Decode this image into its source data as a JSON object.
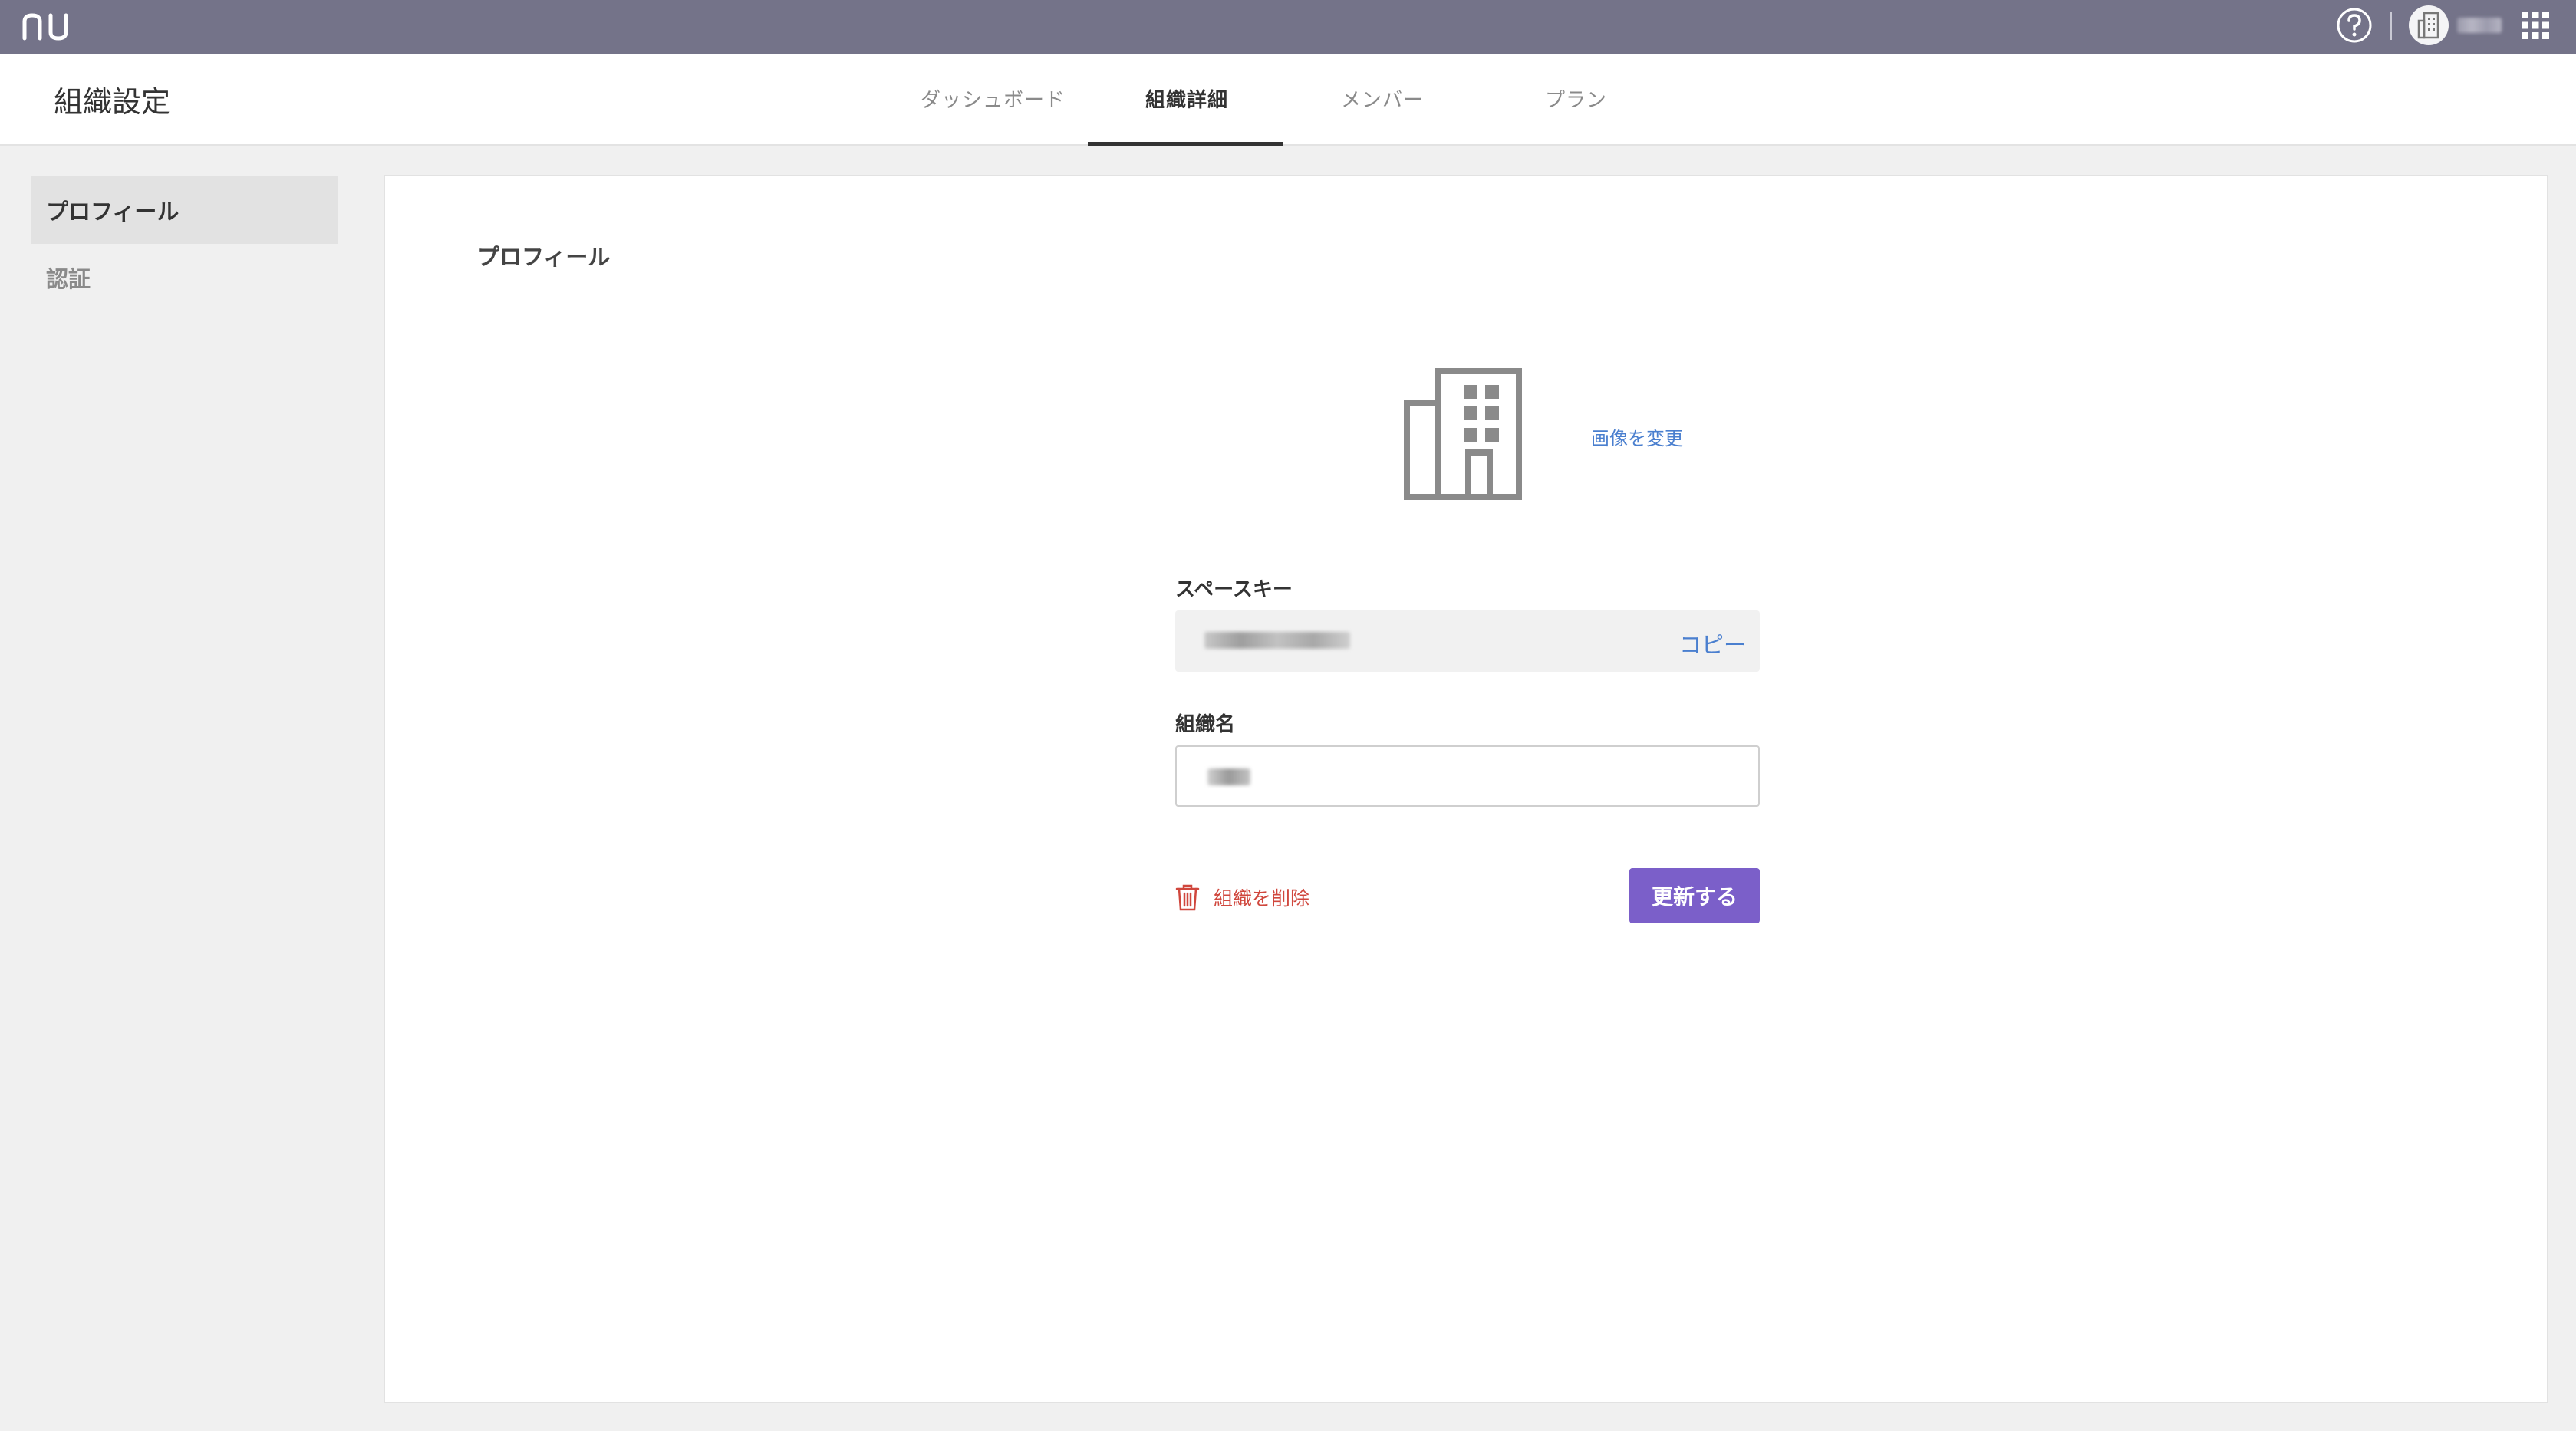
{
  "topbar": {
    "logo": "nu",
    "help_icon": "question-circle-icon",
    "apps_icon": "grid-icon",
    "avatar_icon": "building-icon"
  },
  "header": {
    "title": "組織設定",
    "tabs": [
      {
        "label": "ダッシュボード",
        "active": false
      },
      {
        "label": "組織詳細",
        "active": true
      },
      {
        "label": "メンバー",
        "active": false
      },
      {
        "label": "プラン",
        "active": false
      }
    ]
  },
  "sidebar": {
    "items": [
      {
        "label": "プロフィール",
        "active": true
      },
      {
        "label": "認証",
        "active": false
      }
    ]
  },
  "profile": {
    "title": "プロフィール",
    "change_image": "画像を変更",
    "space_key_label": "スペースキー",
    "copy_label": "コピー",
    "org_name_label": "組織名",
    "delete_label": "組織を削除",
    "update_label": "更新する"
  },
  "colors": {
    "topbar": "#747389",
    "accent": "#7b5fc9",
    "link": "#4a7fcf",
    "danger": "#d0473d"
  }
}
